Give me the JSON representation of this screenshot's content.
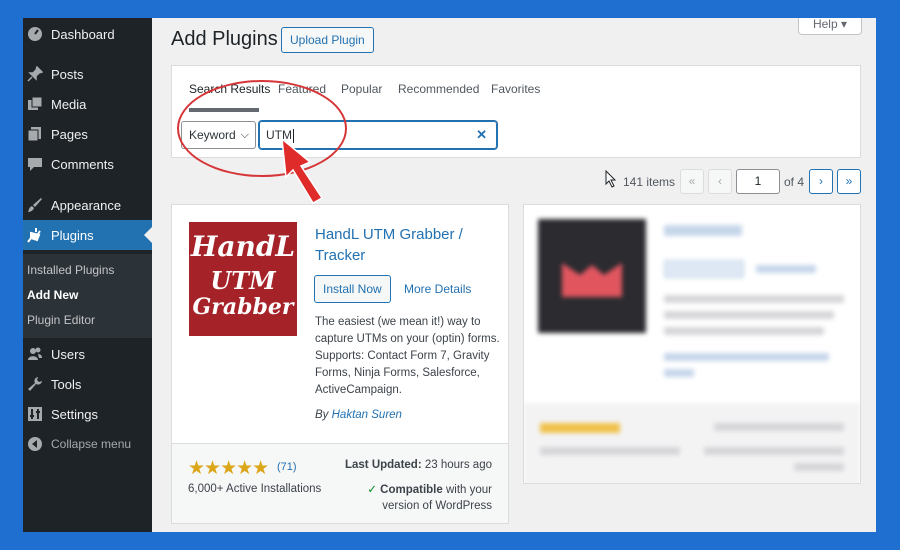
{
  "sidebar": {
    "items": [
      {
        "label": "Dashboard",
        "icon": "dashboard-icon"
      },
      {
        "label": "Posts",
        "icon": "pin-icon"
      },
      {
        "label": "Media",
        "icon": "media-icon"
      },
      {
        "label": "Pages",
        "icon": "pages-icon"
      },
      {
        "label": "Comments",
        "icon": "comment-icon"
      },
      {
        "label": "Appearance",
        "icon": "brush-icon"
      },
      {
        "label": "Plugins",
        "icon": "plugin-icon"
      },
      {
        "label": "Users",
        "icon": "users-icon"
      },
      {
        "label": "Tools",
        "icon": "wrench-icon"
      },
      {
        "label": "Settings",
        "icon": "settings-icon"
      }
    ],
    "submenu": [
      "Installed Plugins",
      "Add New",
      "Plugin Editor"
    ],
    "collapse": "Collapse menu"
  },
  "header": {
    "title": "Add Plugins",
    "upload_label": "Upload Plugin",
    "help_label": "Help ▾"
  },
  "filter": {
    "tabs": [
      "Search Results",
      "Featured",
      "Popular",
      "Recommended",
      "Favorites"
    ],
    "keyword_select": "Keyword",
    "search_value": "UTM"
  },
  "pagination": {
    "items": "141 items",
    "first": "«",
    "prev": "‹",
    "current_page": "1",
    "of_label": "of 4",
    "next": "›",
    "last": "»"
  },
  "plugin": {
    "thumb_line1": "HandL",
    "thumb_line2": "UTM",
    "thumb_line3": "Grabber",
    "name": "HandL UTM Grabber / Tracker",
    "install_label": "Install Now",
    "details_label": "More Details",
    "description": "The easiest (we mean it!) way to capture UTMs on your (optin) forms. Supports: Contact Form 7, Gravity Forms, Ninja Forms, Salesforce, ActiveCampaign.",
    "author_prefix": "By ",
    "author": "Haktan Suren",
    "stars": "★★★★★",
    "rating_count": "(71)",
    "installs": "6,000+ Active Installations",
    "last_updated_label": "Last Updated:",
    "last_updated_value": " 23 hours ago",
    "compat_check": "✓",
    "compat_label": "Compatible",
    "compat_rest": " with your version of WordPress"
  },
  "colors": {
    "accent": "#2271b1",
    "sidebar": "#1d2327",
    "annotation": "#d63638",
    "frame": "#1e6fd0"
  }
}
